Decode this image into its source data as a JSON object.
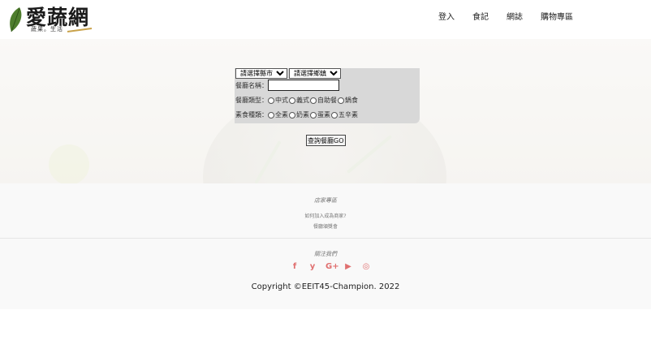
{
  "header": {
    "logo_title": "愛蔬網",
    "logo_subtitle": "蔬果。生活",
    "nav": [
      "登入",
      "食記",
      "網誌",
      "購物專區"
    ]
  },
  "search": {
    "county_select": "請選擇縣市",
    "district_select": "請選擇鄉鎮",
    "name_label": "餐廳名稱：",
    "name_value": "",
    "type_label": "餐廳類型：",
    "types": [
      "中式",
      "義式",
      "自助餐",
      "鍋食"
    ],
    "veg_label": "素食種類：",
    "veg_types": [
      "全素",
      "奶素",
      "蛋素",
      "五辛素"
    ],
    "go_button": "查詢餐廳GO"
  },
  "footer": {
    "section_title": "店家專區",
    "links": [
      "如何加入成為商家?",
      "餐廳頒獎會"
    ],
    "follow_title": "關注我們",
    "social_icons": [
      "facebook-icon",
      "twitter-icon",
      "google-plus-icon",
      "youtube-icon",
      "instagram-icon"
    ],
    "social_glyphs": [
      "f",
      "y",
      "G+",
      "▶",
      "◎"
    ],
    "copyright": "Copyright ©EEIT45-Champion. 2022",
    "accent_color": "#e07070"
  }
}
